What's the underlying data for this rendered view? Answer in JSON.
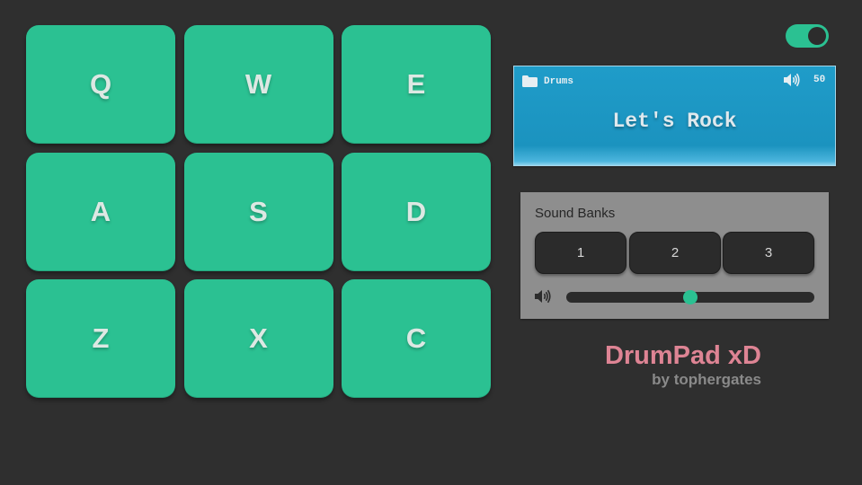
{
  "pads": [
    {
      "key": "Q"
    },
    {
      "key": "W"
    },
    {
      "key": "E"
    },
    {
      "key": "A"
    },
    {
      "key": "S"
    },
    {
      "key": "D"
    },
    {
      "key": "Z"
    },
    {
      "key": "X"
    },
    {
      "key": "C"
    }
  ],
  "power": {
    "on": true
  },
  "display": {
    "bank_name": "Drums",
    "volume": "50",
    "message": "Let's Rock"
  },
  "panel": {
    "title": "Sound Banks",
    "banks": [
      "1",
      "2",
      "3"
    ],
    "volume_level": 0.5
  },
  "brand": {
    "title": "DrumPad xD",
    "subtitle": "by tophergates"
  },
  "colors": {
    "accent": "#2bc192",
    "background": "#2f2f2f",
    "display": "#1b93bf",
    "brand": "#de8494"
  },
  "icons": {
    "folder": "folder-icon",
    "speaker": "speaker-icon"
  }
}
